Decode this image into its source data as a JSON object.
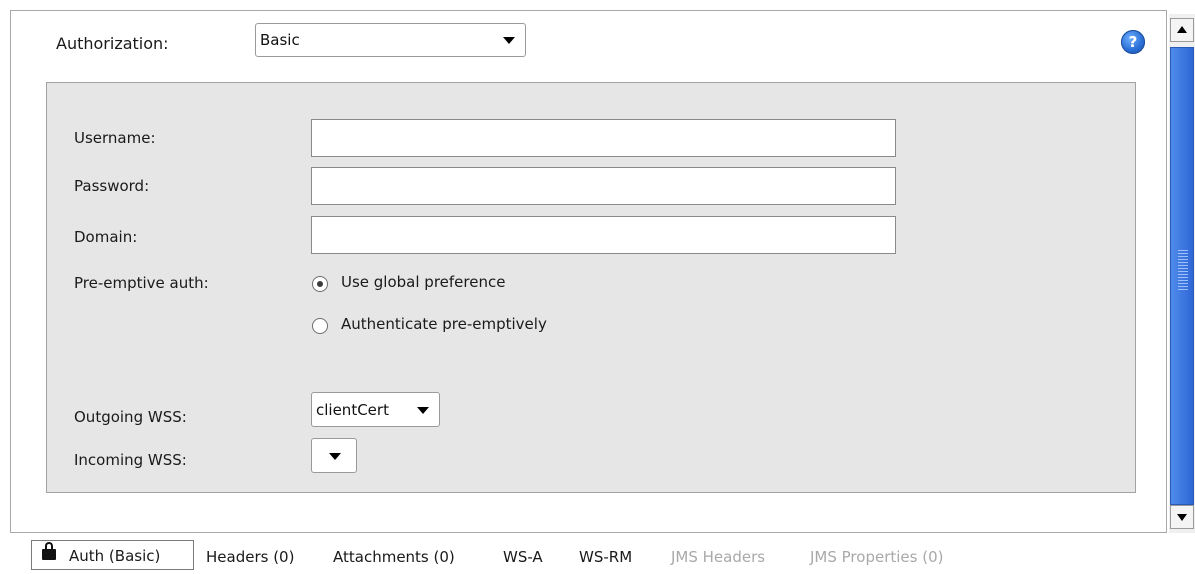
{
  "authorization": {
    "label": "Authorization:",
    "selected": "Basic",
    "help_icon": "?"
  },
  "form": {
    "username_label": "Username:",
    "password_label": "Password:",
    "domain_label": "Domain:",
    "username_value": "",
    "password_value": "",
    "domain_value": "",
    "preemptive_label": "Pre-emptive auth:",
    "preemptive_options": [
      {
        "label": "Use global preference",
        "selected": true
      },
      {
        "label": "Authenticate pre-emptively",
        "selected": false
      }
    ],
    "outgoing_wss_label": "Outgoing WSS:",
    "outgoing_wss_value": "clientCert",
    "incoming_wss_label": "Incoming WSS:",
    "incoming_wss_value": ""
  },
  "tabs": [
    {
      "label": "Auth (Basic)",
      "icon": "lock-icon",
      "selected": true,
      "enabled": true
    },
    {
      "label": "Headers (0)",
      "selected": false,
      "enabled": true
    },
    {
      "label": "Attachments (0)",
      "selected": false,
      "enabled": true
    },
    {
      "label": "WS-A",
      "selected": false,
      "enabled": true
    },
    {
      "label": "WS-RM",
      "selected": false,
      "enabled": true
    },
    {
      "label": "JMS Headers",
      "selected": false,
      "enabled": false
    },
    {
      "label": "JMS Properties (0)",
      "selected": false,
      "enabled": false
    }
  ],
  "colors": {
    "panel_bg": "#e6e6e6",
    "scroll_thumb": "#2f67d6",
    "disabled_text": "#a9a9a9"
  }
}
